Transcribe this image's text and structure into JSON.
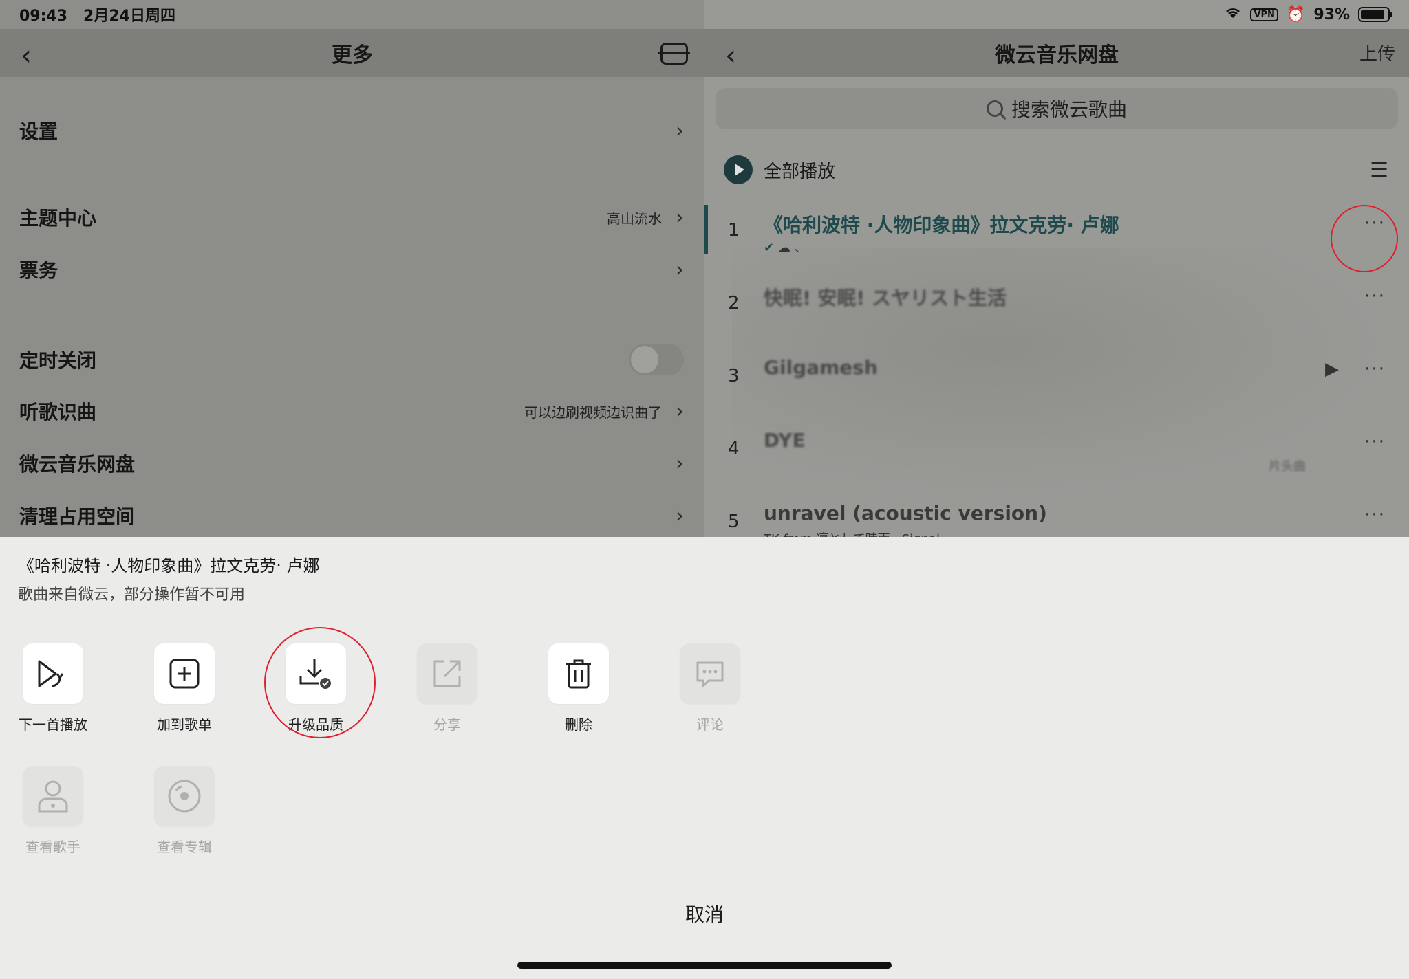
{
  "status": {
    "time": "09:43",
    "date": "2月24日周四",
    "vpn_label": "VPN",
    "battery": "93%"
  },
  "left": {
    "title": "更多",
    "rows": [
      {
        "label": "设置",
        "value": ""
      },
      {
        "label": "主题中心",
        "value": "高山流水"
      },
      {
        "label": "票务",
        "value": ""
      },
      {
        "label": "定时关闭",
        "value": ""
      },
      {
        "label": "听歌识曲",
        "value": "可以边刷视频边识曲了"
      },
      {
        "label": "微云音乐网盘",
        "value": ""
      },
      {
        "label": "清理占用空间",
        "value": ""
      }
    ]
  },
  "right": {
    "title": "微云音乐网盘",
    "upload": "上传",
    "search_placeholder": "搜索微云歌曲",
    "play_all": "全部播放",
    "songs": [
      {
        "num": "1",
        "name": "《哈利波特 ·人物印象曲》拉文克劳· 卢娜",
        "sub": "、"
      },
      {
        "num": "2",
        "name": "快眠! 安眠! スヤリスト生活",
        "sub": ""
      },
      {
        "num": "3",
        "name": "Gilgamesh",
        "sub": ""
      },
      {
        "num": "4",
        "name": "DYE",
        "sub": "片头曲"
      },
      {
        "num": "5",
        "name": "unravel (acoustic version)",
        "sub": "TK from 凛として時雨 · Signal"
      }
    ]
  },
  "sheet": {
    "song_title": "《哈利波特 ·人物印象曲》拉文克劳· 卢娜",
    "note": "歌曲来自微云，部分操作暂不可用",
    "actions": [
      {
        "label": "下一首播放",
        "icon": "play-next-icon",
        "enabled": true
      },
      {
        "label": "加到歌单",
        "icon": "add-to-playlist-icon",
        "enabled": true
      },
      {
        "label": "升级品质",
        "icon": "download-upgrade-icon",
        "enabled": true
      },
      {
        "label": "分享",
        "icon": "share-icon",
        "enabled": false
      },
      {
        "label": "删除",
        "icon": "trash-icon",
        "enabled": true
      },
      {
        "label": "评论",
        "icon": "comment-icon",
        "enabled": false
      },
      {
        "label": "查看歌手",
        "icon": "artist-icon",
        "enabled": false
      },
      {
        "label": "查看专辑",
        "icon": "album-icon",
        "enabled": false
      }
    ],
    "cancel": "取消"
  },
  "colors": {
    "accent": "#1e4a4d",
    "highlight_ring": "#e01e2e",
    "sheet_bg": "#ebebea"
  }
}
